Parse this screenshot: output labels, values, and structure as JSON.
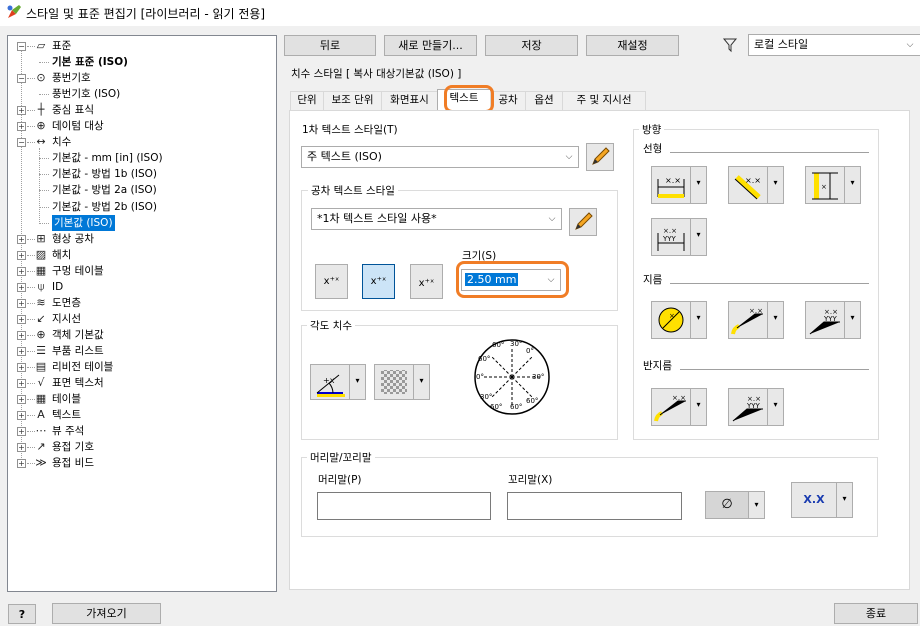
{
  "window": {
    "title": "스타일 및 표준 편집기 [라이브러리 - 읽기 전용]"
  },
  "tree": {
    "items": [
      {
        "label": "표준",
        "bold": false
      },
      {
        "label": "기본 표준 (ISO)",
        "bold": true
      },
      {
        "label": "풍번기호",
        "bold": false
      },
      {
        "label": "풍번기호 (ISO)",
        "bold": false
      },
      {
        "label": "중심 표식",
        "bold": false
      },
      {
        "label": "데이텀 대상",
        "bold": false
      },
      {
        "label": "치수",
        "bold": false
      },
      {
        "label": "기본값 - mm [in] (ISO)",
        "bold": false
      },
      {
        "label": "기본값 - 방법 1b (ISO)",
        "bold": false
      },
      {
        "label": "기본값 - 방법 2a (ISO)",
        "bold": false
      },
      {
        "label": "기본값 - 방법 2b (ISO)",
        "bold": false
      },
      {
        "label": "기본값 (ISO)",
        "bold": false
      },
      {
        "label": "형상 공차",
        "bold": false
      },
      {
        "label": "해치",
        "bold": false
      },
      {
        "label": "구멍 테이블",
        "bold": false
      },
      {
        "label": "ID",
        "bold": false
      },
      {
        "label": "도면층",
        "bold": false
      },
      {
        "label": "지시선",
        "bold": false
      },
      {
        "label": "객체 기본값",
        "bold": false
      },
      {
        "label": "부품 리스트",
        "bold": false
      },
      {
        "label": "리비전 테이블",
        "bold": false
      },
      {
        "label": "표면 텍스처",
        "bold": false
      },
      {
        "label": "테이블",
        "bold": false
      },
      {
        "label": "텍스트",
        "bold": false
      },
      {
        "label": "뷰 주석",
        "bold": false
      },
      {
        "label": "용접 기호",
        "bold": false
      },
      {
        "label": "용접 비드",
        "bold": false
      }
    ]
  },
  "toolbar": {
    "back": "뒤로",
    "new": "새로 만들기...",
    "save": "저장",
    "reset": "재설정",
    "filter_value": "로컬 스타일"
  },
  "style_header": "치수 스타일 [ 복사 대상기본값 (ISO) ]",
  "tabs": [
    "단위",
    "보조 단위",
    "화면표시",
    "텍스트",
    "공차",
    "옵션",
    "주 및 지시선"
  ],
  "text_tab": {
    "primary_text_label": "1차 텍스트 스타일(T)",
    "primary_text_value": "주 텍스트 (ISO)",
    "tol_text_group": "공차 텍스트 스타일",
    "tol_text_value": "*1차 텍스트 스타일 사용*",
    "size_label": "크기(S)",
    "size_value": "2.50 mm",
    "stack_glyph": "x⁺ˣ",
    "angle_group": "각도 치수",
    "dial_labels": [
      "60°",
      "30°",
      "0°",
      "30°",
      "60°",
      "60°",
      "60°",
      "30°",
      "0°",
      "60°"
    ],
    "direction_group": "방향",
    "linear_label": "선형",
    "diameter_label": "지름",
    "radius_label": "반지름",
    "prefix_group": "머리말/꼬리말",
    "prefix_label": "머리말(P)",
    "suffix_label": "꼬리말(X)",
    "prefix_value": "",
    "suffix_value": "",
    "symbol_value": "∅",
    "format_value": "X.X"
  },
  "footer": {
    "help": "?",
    "import": "가져오기",
    "close": "종료"
  },
  "colors": {
    "highlight": "#f07d26",
    "selection": "#0078d7",
    "accent_yellow": "#ffe000"
  }
}
